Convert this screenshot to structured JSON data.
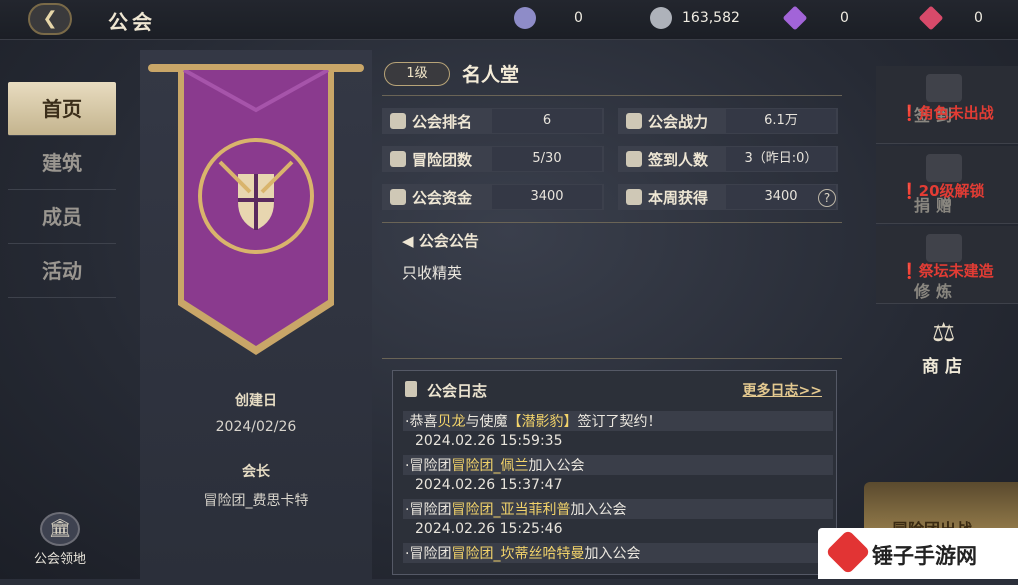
{
  "header": {
    "title": "公会",
    "currencies": [
      {
        "icon": "crystal-plus-icon",
        "value": "0",
        "color": "#b7b6e6"
      },
      {
        "icon": "silver-plus-icon",
        "value": "163,582",
        "color": "#cfd2d8"
      },
      {
        "icon": "diamond-icon",
        "value": "0",
        "color": "#b77ae8"
      },
      {
        "icon": "ruby-plus-icon",
        "value": "0",
        "color": "#e85a7a"
      }
    ]
  },
  "nav": {
    "items": [
      "首页",
      "建筑",
      "成员",
      "活动"
    ],
    "active_index": 0,
    "guild_land": "公会领地"
  },
  "banner": {
    "founded_label": "创建日",
    "founded_value": "2024/02/26",
    "leader_label": "会长",
    "leader_value": "冒险团_费思卡特",
    "primary_color": "#8a3a8e",
    "trim_color": "#d9b46c"
  },
  "guild": {
    "level": "1级",
    "name": "名人堂",
    "stats": [
      {
        "label": "公会排名",
        "value": "6",
        "icon": "trophy-icon"
      },
      {
        "label": "公会战力",
        "value": "6.1万",
        "icon": "crossed-swords-icon"
      },
      {
        "label": "冒险团数",
        "value": "5/30",
        "icon": "team-icon"
      },
      {
        "label": "签到人数",
        "value": "3（昨日:0）",
        "icon": "checkin-icon"
      },
      {
        "label": "公会资金",
        "value": "3400",
        "icon": "money-bag-icon"
      },
      {
        "label": "本周获得",
        "value": "3400",
        "icon": "coin-stack-icon"
      }
    ],
    "help": "?"
  },
  "notice": {
    "title": "公会公告",
    "text": "只收精英"
  },
  "log": {
    "title": "公会日志",
    "more": "更多日志>>",
    "entries": [
      {
        "pre": "·恭喜",
        "hl1": "贝龙",
        "mid": "与使魔",
        "hl2": "【潜影豹】",
        "post": "签订了契约！",
        "time": "2024.02.26 15:59:35"
      },
      {
        "pre": "·冒险团",
        "hl1": "冒险团_佩兰",
        "mid": "加入公会",
        "hl2": "",
        "post": "",
        "time": "2024.02.26 15:37:47"
      },
      {
        "pre": "·冒险团",
        "hl1": "冒险团_亚当菲利普",
        "mid": "加入公会",
        "hl2": "",
        "post": "",
        "time": "2024.02.26 15:25:46"
      },
      {
        "pre": "·冒险团",
        "hl1": "冒险团_坎蒂丝哈特曼",
        "mid": "加入公会",
        "hl2": "",
        "post": "",
        "time": ""
      }
    ]
  },
  "right": {
    "checkin": {
      "ghost": "签到",
      "warn": "❗角色未出战"
    },
    "donate": {
      "ghost": "捐赠",
      "warn": "❗20级解锁"
    },
    "refine": {
      "ghost": "修炼",
      "warn": "❗祭坛未建造"
    },
    "shop": "商店",
    "battle": "冒险团出战"
  },
  "watermark": "锤子手游网"
}
